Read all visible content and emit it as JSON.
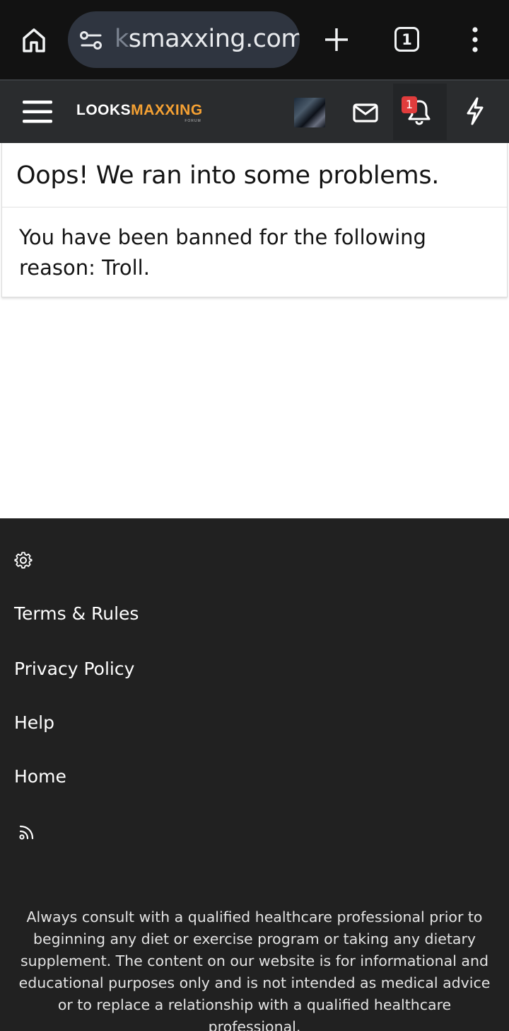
{
  "browser": {
    "url_faded": "k",
    "url_text": "smaxxing.com",
    "tab_count": "1",
    "icons": [
      "home-icon",
      "site-settings-icon",
      "new-tab-icon",
      "tab-switcher-icon",
      "more-menu-icon"
    ]
  },
  "site_header": {
    "logo_looks": "LOOKS",
    "logo_maxxing": "MAXXING",
    "logo_forum": "FORUM",
    "notification_count": "1",
    "colors": {
      "logo_accent": "#f5a133",
      "badge": "#e03c3c",
      "header_bg": "#2a2c2e"
    },
    "icons": [
      "menu-icon",
      "avatar",
      "mail-icon",
      "bell-icon",
      "bolt-icon"
    ]
  },
  "error": {
    "title": "Oops! We ran into some problems.",
    "message": "You have been banned for the following reason: Troll."
  },
  "footer": {
    "links": [
      "Terms & Rules",
      "Privacy Policy",
      "Help",
      "Home"
    ],
    "disclaimer": "Always consult with a qualified healthcare professional prior to beginning any diet or exercise program or taking any dietary supplement. The content on our website is for informational and educational purposes only and is not intended as medical advice or to replace a relationship with a qualified healthcare professional.",
    "icons": [
      "gear-icon",
      "rss-icon"
    ]
  }
}
